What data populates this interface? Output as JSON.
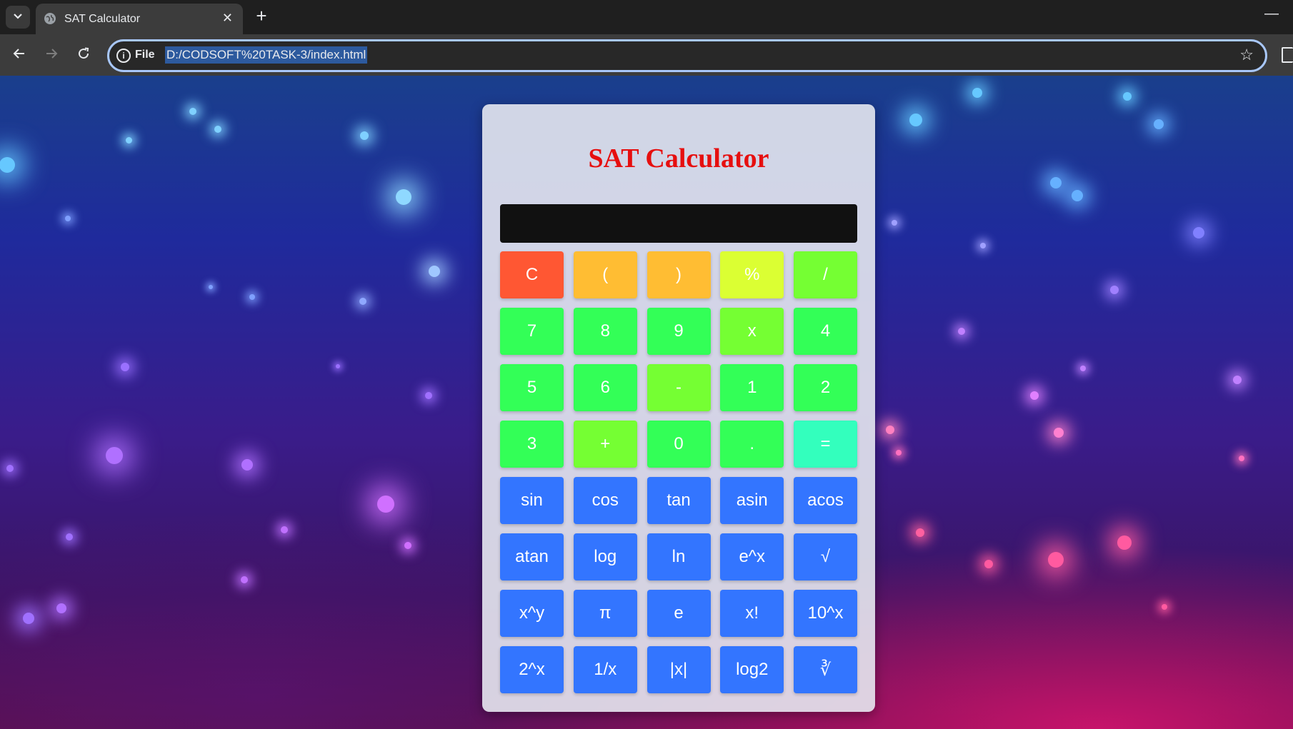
{
  "browser": {
    "tab_title": "SAT Calculator",
    "scheme_label": "File",
    "url": "D:/CODSOFT%20TASK-3/index.html",
    "icons": {
      "tab_list": "chevron-down-icon",
      "favicon": "globe-icon",
      "close_tab": "close-icon",
      "new_tab": "plus-icon",
      "minimize": "minimize-icon",
      "back": "back-arrow-icon",
      "forward": "forward-arrow-icon",
      "reload": "reload-icon",
      "site_info": "info-icon",
      "bookmark": "star-icon",
      "side_panel": "side-panel-icon"
    }
  },
  "calculator": {
    "title": "SAT Calculator",
    "display_value": "",
    "title_color": "#e60f0f",
    "keys": [
      {
        "label": "C",
        "kind": "clear",
        "color": "#ff5733"
      },
      {
        "label": "(",
        "kind": "paren",
        "color": "#ffbd33"
      },
      {
        "label": ")",
        "kind": "paren",
        "color": "#ffbd33"
      },
      {
        "label": "%",
        "kind": "percent",
        "color": "#dbff33"
      },
      {
        "label": "/",
        "kind": "operator",
        "color": "#75ff33"
      },
      {
        "label": "7",
        "kind": "digit",
        "color": "#33ff57"
      },
      {
        "label": "8",
        "kind": "digit",
        "color": "#33ff57"
      },
      {
        "label": "9",
        "kind": "digit",
        "color": "#33ff57"
      },
      {
        "label": "x",
        "kind": "operator",
        "color": "#75ff33"
      },
      {
        "label": "4",
        "kind": "digit",
        "color": "#33ff57"
      },
      {
        "label": "5",
        "kind": "digit",
        "color": "#33ff57"
      },
      {
        "label": "6",
        "kind": "digit",
        "color": "#33ff57"
      },
      {
        "label": "-",
        "kind": "operator",
        "color": "#75ff33"
      },
      {
        "label": "1",
        "kind": "digit",
        "color": "#33ff57"
      },
      {
        "label": "2",
        "kind": "digit",
        "color": "#33ff57"
      },
      {
        "label": "3",
        "kind": "digit",
        "color": "#33ff57"
      },
      {
        "label": "+",
        "kind": "operator",
        "color": "#75ff33"
      },
      {
        "label": "0",
        "kind": "digit",
        "color": "#33ff57"
      },
      {
        "label": ".",
        "kind": "digit",
        "color": "#33ff57"
      },
      {
        "label": "=",
        "kind": "equals",
        "color": "#33ffbd"
      },
      {
        "label": "sin",
        "kind": "function",
        "color": "#3375ff"
      },
      {
        "label": "cos",
        "kind": "function",
        "color": "#3375ff"
      },
      {
        "label": "tan",
        "kind": "function",
        "color": "#3375ff"
      },
      {
        "label": "asin",
        "kind": "function",
        "color": "#3375ff"
      },
      {
        "label": "acos",
        "kind": "function",
        "color": "#3375ff"
      },
      {
        "label": "atan",
        "kind": "function",
        "color": "#3375ff"
      },
      {
        "label": "log",
        "kind": "function",
        "color": "#3375ff"
      },
      {
        "label": "ln",
        "kind": "function",
        "color": "#3375ff"
      },
      {
        "label": "e^x",
        "kind": "function",
        "color": "#3375ff"
      },
      {
        "label": "√",
        "kind": "function",
        "color": "#3375ff"
      },
      {
        "label": "x^y",
        "kind": "function",
        "color": "#3375ff"
      },
      {
        "label": "π",
        "kind": "function",
        "color": "#3375ff"
      },
      {
        "label": "e",
        "kind": "function",
        "color": "#3375ff"
      },
      {
        "label": "x!",
        "kind": "function",
        "color": "#3375ff"
      },
      {
        "label": "10^x",
        "kind": "function",
        "color": "#3375ff"
      },
      {
        "label": "2^x",
        "kind": "function",
        "color": "#3375ff"
      },
      {
        "label": "1/x",
        "kind": "function",
        "color": "#3375ff"
      },
      {
        "label": "|x|",
        "kind": "function",
        "color": "#3375ff"
      },
      {
        "label": "log2",
        "kind": "function",
        "color": "#3375ff"
      },
      {
        "label": "∛",
        "kind": "function",
        "color": "#3375ff"
      }
    ]
  }
}
